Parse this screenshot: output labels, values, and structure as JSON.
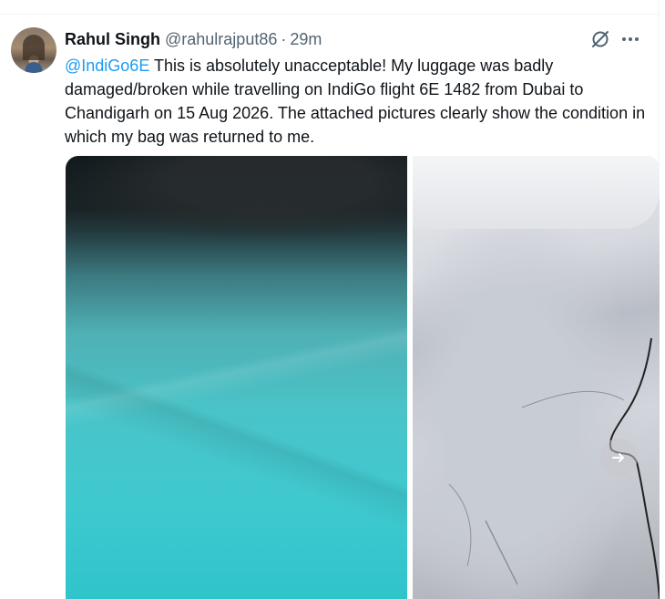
{
  "tweet": {
    "author_name": "Rahul Singh",
    "author_handle": "@rahulrajput86",
    "separator": "·",
    "time": "29m",
    "mention": "@IndiGo6E",
    "body": " This is absolutely unacceptable! My luggage was badly damaged/broken while travelling on IndiGo flight 6E 1482 from Dubai to Chandigarh on 15 Aug 2026. The attached pictures clearly show the condition in which my bag was returned to me.",
    "icons": {
      "grok": "grok-icon",
      "more": "more-icon",
      "next": "chevron-right-icon"
    },
    "colors": {
      "mention": "#1d9bf0",
      "secondary_text": "#536471",
      "primary_text": "#0f1419"
    }
  }
}
